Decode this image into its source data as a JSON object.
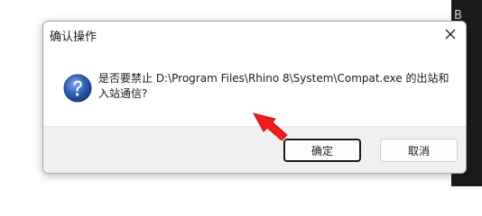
{
  "dialog": {
    "title": "确认操作",
    "message": "是否要禁止 D:\\Program Files\\Rhino 8\\System\\Compat.exe 的出站和入站通信?",
    "buttons": {
      "ok_label": "确定",
      "cancel_label": "取消"
    }
  },
  "background": {
    "edge_char": "B"
  },
  "icons": {
    "close": "close-icon",
    "question": "question-icon",
    "pointer": "red-arrow-icon"
  },
  "colors": {
    "footer_bg": "#f0f0f0",
    "question_blue": "#2a5aa8",
    "arrow_red": "#ee1c1c",
    "dark_strip": "#1b1b1b"
  }
}
